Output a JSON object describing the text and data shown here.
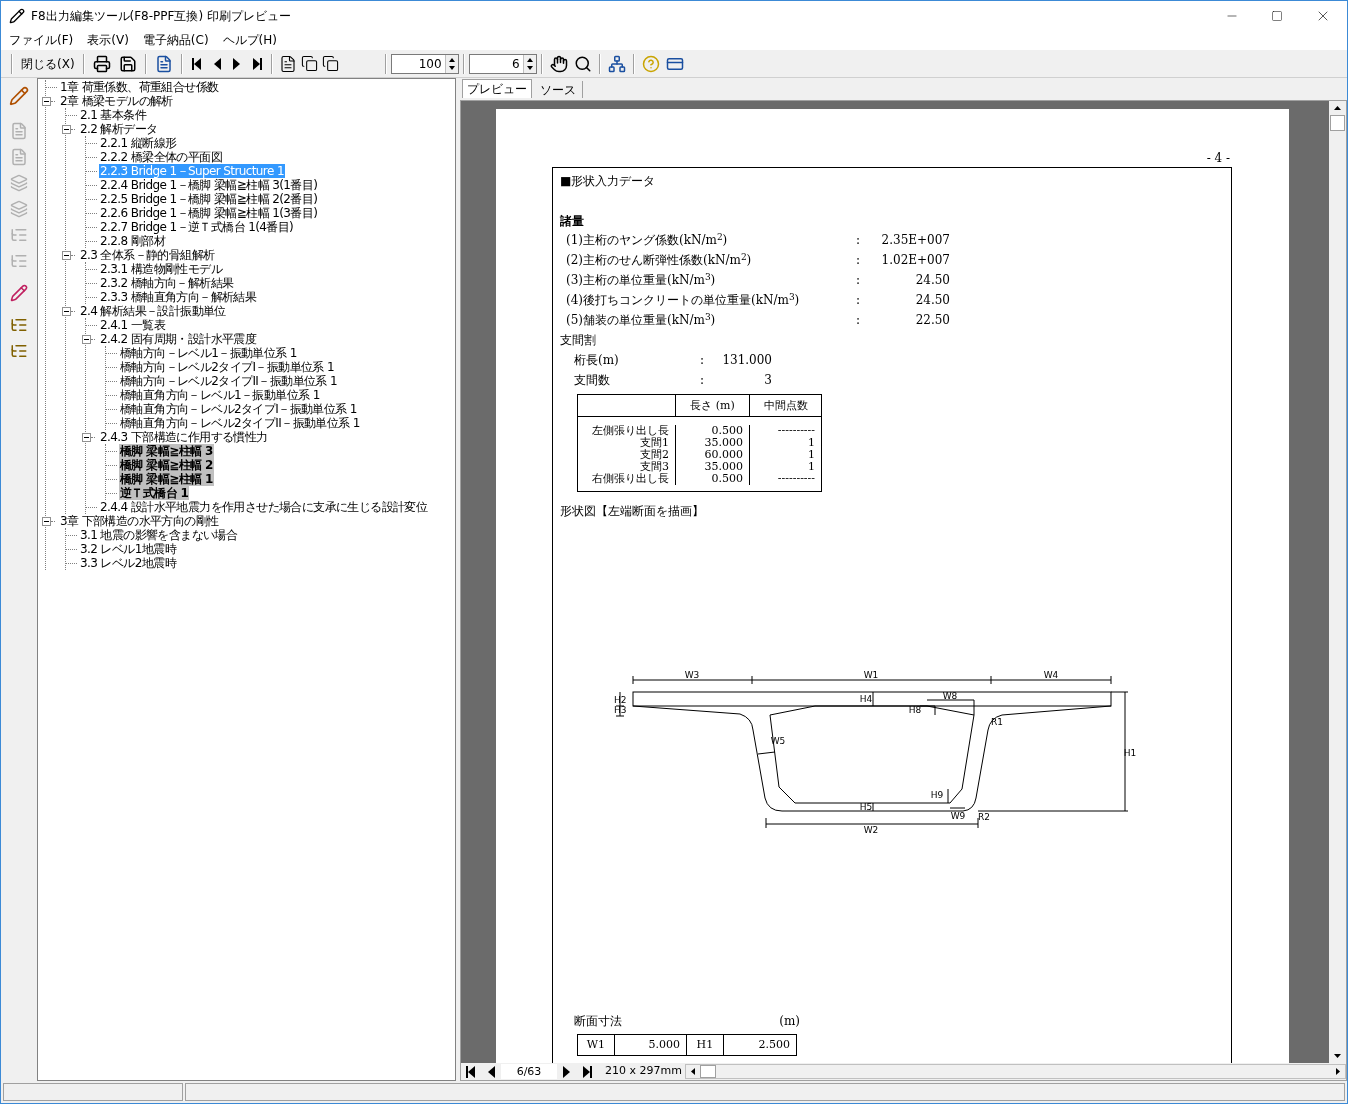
{
  "window": {
    "title": "F8出力編集ツール(F8-PPF互換) 印刷プレビュー"
  },
  "menu": [
    "ファイル(F)",
    "表示(V)",
    "電子納品(C)",
    "ヘルプ(H)"
  ],
  "toolbar": {
    "close_label": "閉じる(X)",
    "zoom": "100",
    "page": "6"
  },
  "tree": [
    {
      "label": "1章 荷重係数、荷重組合せ係数",
      "selected": false,
      "highlighted": false
    },
    {
      "label": "2章 橋梁モデルの解析",
      "selected": false,
      "highlighted": false,
      "expanded": true,
      "children": [
        {
          "label": "2.1 基本条件",
          "selected": false,
          "highlighted": false
        },
        {
          "label": "2.2 解析データ",
          "selected": false,
          "highlighted": false,
          "expanded": true,
          "children": [
            {
              "label": "2.2.1 縦断線形",
              "selected": false,
              "highlighted": false
            },
            {
              "label": "2.2.2 橋梁全体の平面図",
              "selected": false,
              "highlighted": false
            },
            {
              "label": "2.2.3 Bridge 1－Super Structure 1",
              "selected": true,
              "highlighted": false
            },
            {
              "label": "2.2.4 Bridge 1－橋脚 梁幅≧柱幅 3(1番目)",
              "selected": false,
              "highlighted": false
            },
            {
              "label": "2.2.5 Bridge 1－橋脚 梁幅≧柱幅 2(2番目)",
              "selected": false,
              "highlighted": false
            },
            {
              "label": "2.2.6 Bridge 1－橋脚 梁幅≧柱幅 1(3番目)",
              "selected": false,
              "highlighted": false
            },
            {
              "label": "2.2.7 Bridge 1－逆Ｔ式橋台 1(4番目)",
              "selected": false,
              "highlighted": false
            },
            {
              "label": "2.2.8 剛部材",
              "selected": false,
              "highlighted": false
            }
          ]
        },
        {
          "label": "2.3 全体系－静的骨組解析",
          "selected": false,
          "highlighted": false,
          "expanded": true,
          "children": [
            {
              "label": "2.3.1 構造物剛性モデル",
              "selected": false,
              "highlighted": false
            },
            {
              "label": "2.3.2 橋軸方向－解析結果",
              "selected": false,
              "highlighted": false
            },
            {
              "label": "2.3.3 橋軸直角方向－解析結果",
              "selected": false,
              "highlighted": false
            }
          ]
        },
        {
          "label": "2.4 解析結果－設計振動単位",
          "selected": false,
          "highlighted": false,
          "expanded": true,
          "children": [
            {
              "label": "2.4.1 一覧表",
              "selected": false,
              "highlighted": false
            },
            {
              "label": "2.4.2 固有周期・設計水平震度",
              "selected": false,
              "highlighted": false,
              "expanded": true,
              "children": [
                {
                  "label": "橋軸方向－レベル1－振動単位系 1",
                  "selected": false,
                  "highlighted": false
                },
                {
                  "label": "橋軸方向－レベル2タイプI－振動単位系 1",
                  "selected": false,
                  "highlighted": false
                },
                {
                  "label": "橋軸方向－レベル2タイプII－振動単位系 1",
                  "selected": false,
                  "highlighted": false
                },
                {
                  "label": "橋軸直角方向－レベル1－振動単位系 1",
                  "selected": false,
                  "highlighted": false
                },
                {
                  "label": "橋軸直角方向－レベル2タイプI－振動単位系 1",
                  "selected": false,
                  "highlighted": false
                },
                {
                  "label": "橋軸直角方向－レベル2タイプII－振動単位系 1",
                  "selected": false,
                  "highlighted": false
                }
              ]
            },
            {
              "label": "2.4.3 下部構造に作用する慣性力",
              "selected": false,
              "highlighted": false,
              "expanded": true,
              "children": [
                {
                  "label": "橋脚 梁幅≧柱幅 3",
                  "selected": false,
                  "highlighted": true
                },
                {
                  "label": "橋脚 梁幅≧柱幅 2",
                  "selected": false,
                  "highlighted": true
                },
                {
                  "label": "橋脚 梁幅≧柱幅 1",
                  "selected": false,
                  "highlighted": true
                },
                {
                  "label": "逆Ｔ式橋台 1",
                  "selected": false,
                  "highlighted": true
                }
              ]
            },
            {
              "label": "2.4.4 設計水平地震力を作用させた場合に支承に生じる設計変位",
              "selected": false,
              "highlighted": false
            }
          ]
        }
      ]
    },
    {
      "label": "3章 下部構造の水平方向の剛性",
      "selected": false,
      "highlighted": false,
      "expanded": true,
      "children": [
        {
          "label": "3.1 地震の影響を含まない場合",
          "selected": false,
          "highlighted": false
        },
        {
          "label": "3.2 レベル1地震時",
          "selected": false,
          "highlighted": false
        },
        {
          "label": "3.3 レベル2地震時",
          "selected": false,
          "highlighted": false
        }
      ]
    }
  ],
  "tabs": [
    {
      "label": "プレビュー",
      "selected": true
    },
    {
      "label": "ソース",
      "selected": false
    }
  ],
  "page": {
    "page_number": "- 4 -",
    "title": "■形状入力データ",
    "properties": {
      "heading": "諸量",
      "items": [
        {
          "label": "(1)主桁のヤング係数(kN/m$^{2}$)",
          "sep": ":",
          "value": "2.35E+007"
        },
        {
          "label": "(2)主桁のせん断弾性係数(kN/m$^{2}$)",
          "sep": ":",
          "value": "1.02E+007"
        },
        {
          "label": "(3)主桁の単位重量(kN/m$^{3}$)",
          "sep": ":",
          "value": "24.50"
        },
        {
          "label": "(4)後打ちコンクリートの単位重量(kN/m$^{3}$)",
          "sep": ":",
          "value": "24.50"
        },
        {
          "label": "(5)舗装の単位重量(kN/m$^{3}$)",
          "sep": ":",
          "value": "22.50"
        }
      ]
    },
    "spans": {
      "heading": "支間割",
      "items": [
        {
          "label": "桁長(m)",
          "sep": ":",
          "value": "131.000"
        },
        {
          "label": "支間数",
          "sep": ":",
          "value": "3"
        }
      ],
      "table": {
        "columns": [
          "長さ (m)",
          "中間点数"
        ],
        "rows": [
          {
            "name": "左側張り出し長",
            "length": "0.500",
            "points": "----------"
          },
          {
            "name": "支間1",
            "length": "35.000",
            "points": "1"
          },
          {
            "name": "支間2",
            "length": "60.000",
            "points": "1"
          },
          {
            "name": "支間3",
            "length": "35.000",
            "points": "1"
          },
          {
            "name": "右側張り出し長",
            "length": "0.500",
            "points": "----------"
          }
        ]
      }
    },
    "figure": {
      "caption": "形状図【左端断面を描画】",
      "labels": [
        "W3",
        "W1",
        "W4",
        "H2",
        "H3",
        "H4",
        "W8",
        "H8",
        "R1",
        "W5",
        "H1",
        "H9",
        "H5",
        "W9",
        "R2",
        "W2"
      ]
    },
    "dimensions": {
      "title": "断面寸法",
      "unit": "(m)",
      "cells": [
        "W1",
        "5.000",
        "H1",
        "2.500"
      ]
    }
  },
  "nav": {
    "page_indicator": "6/63",
    "paper": "210 x 297mm"
  }
}
